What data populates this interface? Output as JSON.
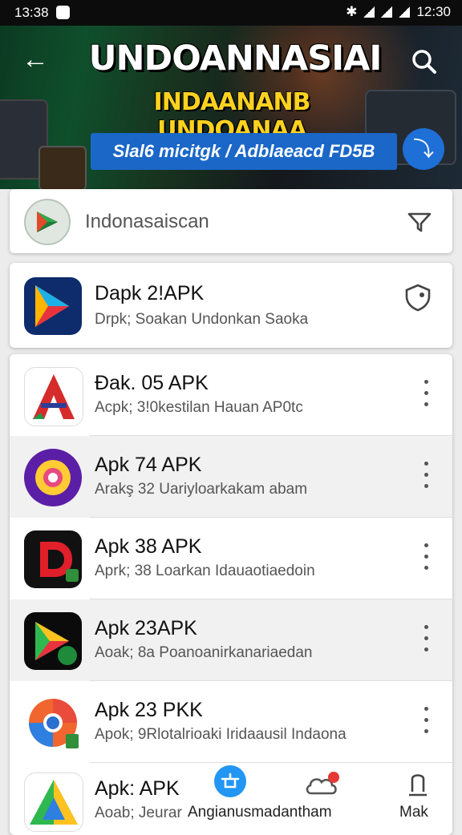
{
  "status_bar": {
    "time_left": "13:38",
    "time_right": "12:30"
  },
  "banner": {
    "title_line1": "UNDOANNASIAI",
    "title_line2": "INDAANANB UNDOANAA",
    "cta_label": "Slal6 micitgk / Adblaeacd FD5B"
  },
  "search": {
    "placeholder": "Indonasaiscan"
  },
  "featured": {
    "title": "Dapk 2!APK",
    "subtitle": "Drpk; Soakan Undonkan Saoka"
  },
  "apps": [
    {
      "title": "Đak. 05 APK",
      "subtitle": "Acpk; 3!0kestilan Hauan AP0tc"
    },
    {
      "title": "Apk 74 APK",
      "subtitle": "Arakş 32 Uariyloarkakam abam"
    },
    {
      "title": "Apk 38 APK",
      "subtitle": "Aprk; 38 Loarkan Idauaotiaedoin"
    },
    {
      "title": "Apk 23APK",
      "subtitle": "Aoak; 8a Poanoanirkanariaedan"
    },
    {
      "title": "Apk 23 PKK",
      "subtitle": "Apok; 9Rlotalrioaki Iridaausil Indaona"
    },
    {
      "title": "Apk: APK",
      "subtitle": "Aoab; Jeurar"
    }
  ],
  "bottom_nav": {
    "center_label": "Angianusmadantham",
    "right_label": "Mak"
  },
  "colors": {
    "accent_blue": "#1a67c8",
    "title_yellow": "#ffd21f",
    "notification_red": "#e53935"
  },
  "icons": [
    "back-arrow-icon",
    "search-icon",
    "filter-icon",
    "shield-icon",
    "more-vert-icon",
    "home-icon",
    "cloud-icon",
    "profile-icon"
  ]
}
